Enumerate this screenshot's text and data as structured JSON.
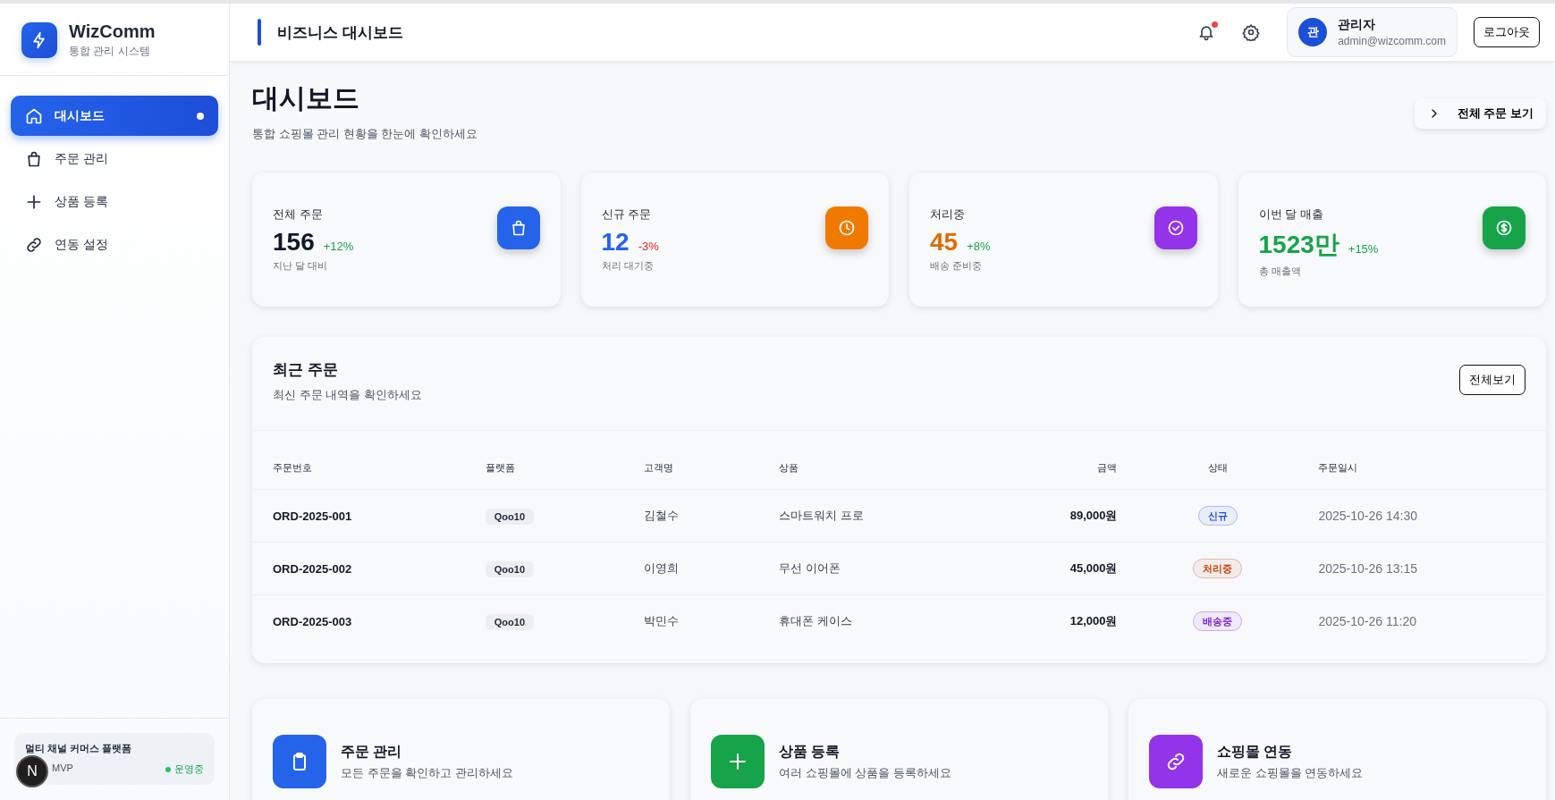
{
  "sidebar": {
    "logo_title": "WizComm",
    "logo_subtitle": "통합 관리 시스템",
    "items": [
      {
        "label": "대시보드",
        "selected": true
      },
      {
        "label": "주문 관리",
        "selected": false
      },
      {
        "label": "상품 등록",
        "selected": false
      },
      {
        "label": "연동 설정",
        "selected": false
      }
    ],
    "footer": {
      "title": "멀티 채널 커머스 플랫폼",
      "version": "MVP",
      "status": "운영중"
    },
    "dev_badge": "N"
  },
  "header": {
    "title": "비즈니스 대시보드",
    "notification_unread": true,
    "user": {
      "avatar": "관",
      "name": "관리자",
      "email": "admin@wizcomm.com"
    },
    "logout": "로그아웃"
  },
  "page": {
    "title": "대시보드",
    "subtitle": "통합 쇼핑몰 관리 현황을 한눈에 확인하세요",
    "action": "전체 주문 보기"
  },
  "stats": [
    {
      "label": "전체 주문",
      "value": "156",
      "change": "+12%",
      "negative": false,
      "note": "지난 달 대비",
      "color": "#111827"
    },
    {
      "label": "신규 주문",
      "value": "12",
      "change": "-3%",
      "negative": true,
      "note": "처리 대기중",
      "color": "#2563eb"
    },
    {
      "label": "처리중",
      "value": "45",
      "change": "+8%",
      "negative": false,
      "note": "배송 준비중",
      "color": "#e06a00"
    },
    {
      "label": "이번 달 매출",
      "value": "1523만",
      "change": "+15%",
      "negative": false,
      "note": "총 매출액",
      "color": "#16a34a"
    }
  ],
  "recent_orders": {
    "title": "최근 주문",
    "subtitle": "최신 주문 내역을 확인하세요",
    "action": "전체보기",
    "columns": [
      "주문번호",
      "플랫폼",
      "고객명",
      "상품",
      "금액",
      "상태",
      "주문일시"
    ],
    "rows": [
      {
        "order_no": "ORD-2025-001",
        "platform": "Qoo10",
        "customer": "김철수",
        "product": "스마트워치 프로",
        "amount": "89,000원",
        "status": "신규",
        "color": "#1d4ed8",
        "date": "2025-10-26 14:30"
      },
      {
        "order_no": "ORD-2025-002",
        "platform": "Qoo10",
        "customer": "이영희",
        "product": "무선 이어폰",
        "amount": "45,000원",
        "status": "처리중",
        "color": "#c2410c",
        "date": "2025-10-26 13:15"
      },
      {
        "order_no": "ORD-2025-003",
        "platform": "Qoo10",
        "customer": "박민수",
        "product": "휴대폰 케이스",
        "amount": "12,000원",
        "status": "배송중",
        "color": "#7e22ce",
        "date": "2025-10-26 11:20"
      }
    ]
  },
  "quick_actions": [
    {
      "title": "주문 관리",
      "desc": "모든 주문을 확인하고 관리하세요"
    },
    {
      "title": "상품 등록",
      "desc": "여러 쇼핑몰에 상품을 등록하세요"
    },
    {
      "title": "쇼핑몰 연동",
      "desc": "새로운 쇼핑몰을 연동하세요"
    }
  ]
}
